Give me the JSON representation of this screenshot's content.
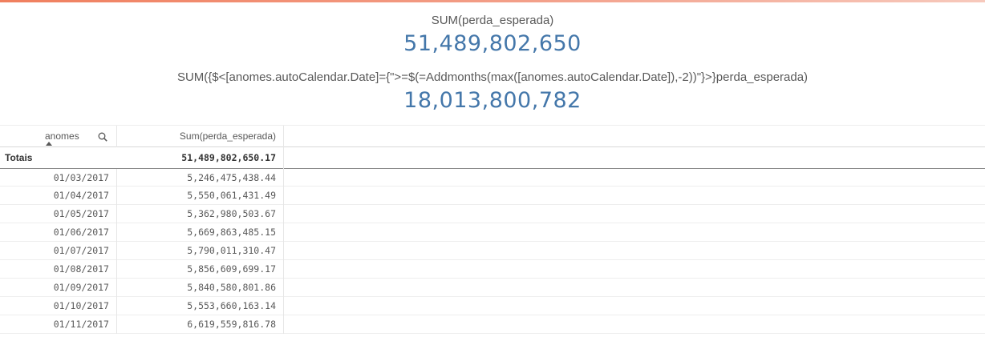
{
  "colors": {
    "accent": "#4477aa",
    "top_bar": "#f07f5e"
  },
  "kpi1": {
    "label": "SUM(perda_esperada)",
    "value": "51,489,802,650"
  },
  "kpi2": {
    "label": "SUM({$<[anomes.autoCalendar.Date]={\">=$(=Addmonths(max([anomes.autoCalendar.Date]),-2))\"}>}perda_esperada)",
    "value": "18,013,800,782"
  },
  "table": {
    "headers": {
      "dimension": "anomes",
      "measure": "Sum(perda_esperada)"
    },
    "search_icon": "search-icon",
    "totals": {
      "label": "Totais",
      "value": "51,489,802,650.17"
    },
    "rows": [
      {
        "date": "01/03/2017",
        "value": "5,246,475,438.44"
      },
      {
        "date": "01/04/2017",
        "value": "5,550,061,431.49"
      },
      {
        "date": "01/05/2017",
        "value": "5,362,980,503.67"
      },
      {
        "date": "01/06/2017",
        "value": "5,669,863,485.15"
      },
      {
        "date": "01/07/2017",
        "value": "5,790,011,310.47"
      },
      {
        "date": "01/08/2017",
        "value": "5,856,609,699.17"
      },
      {
        "date": "01/09/2017",
        "value": "5,840,580,801.86"
      },
      {
        "date": "01/10/2017",
        "value": "5,553,660,163.14"
      },
      {
        "date": "01/11/2017",
        "value": "6,619,559,816.78"
      }
    ]
  }
}
